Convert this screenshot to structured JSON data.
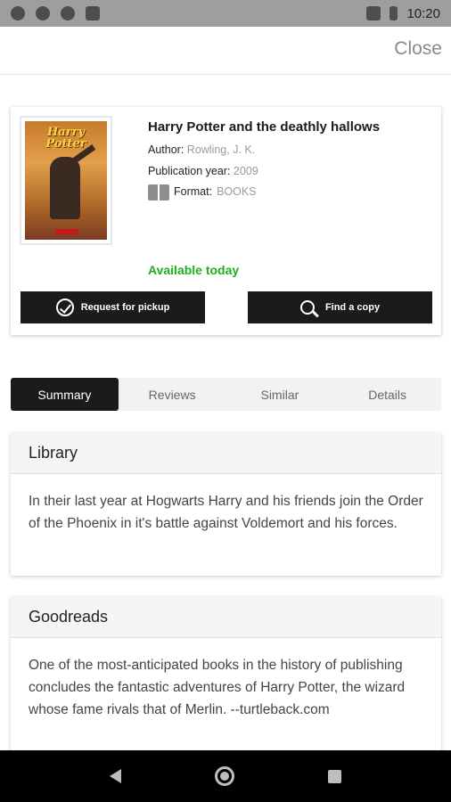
{
  "status": {
    "time": "10:20"
  },
  "topbar": {
    "close_label": "Close"
  },
  "book": {
    "cover_title": "Harry Potter",
    "title": "Harry Potter and the deathly hallows",
    "author_label": "Author:",
    "author_value": "Rowling, J. K.",
    "year_label": "Publication year:",
    "year_value": "2009",
    "format_label": "Format:",
    "format_value": "BOOKS",
    "availability": "Available today",
    "request_label": "Request for pickup",
    "find_label": "Find a copy",
    "colors": {
      "available": "#1db11d",
      "button": "#1b1b1b"
    }
  },
  "tabs": [
    {
      "label": "Summary",
      "active": true
    },
    {
      "label": "Reviews",
      "active": false
    },
    {
      "label": "Similar",
      "active": false
    },
    {
      "label": "Details",
      "active": false
    }
  ],
  "panels": {
    "library": {
      "title": "Library",
      "text": "In their last year at Hogwarts Harry and his friends join the Order of the Phoenix in it's battle against Voldemort and his forces."
    },
    "goodreads": {
      "title": "Goodreads",
      "text": "One of the most-anticipated books in the history of publishing concludes the fantastic adventures of Harry Potter, the wizard whose fame rivals that of Merlin. --turtleback.com"
    }
  },
  "icons": [
    "settings-icon",
    "signal-icon",
    "circle-icon",
    "sd-card-icon",
    "battery-icon",
    "check-circle-icon",
    "search-icon",
    "book-icon",
    "back-icon",
    "home-icon",
    "recents-icon"
  ]
}
